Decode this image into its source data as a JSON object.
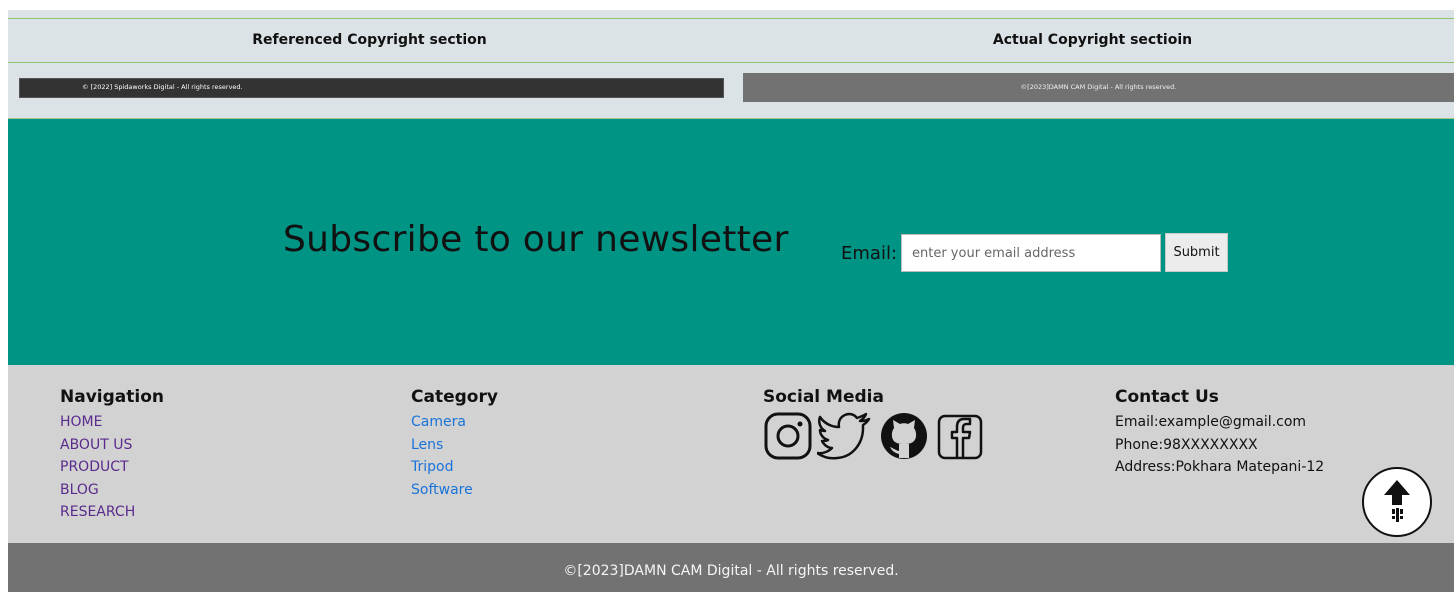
{
  "comparison": {
    "referenced_heading": "Referenced Copyright section",
    "actual_heading": "Actual Copyright sectioin",
    "referenced_text": "© [2022] Spidaworks Digital - All rights reserved.",
    "actual_text": "©[2023]DAMN CAM Digital - All rights reserved."
  },
  "newsletter": {
    "title": "Subscribe to our newsletter",
    "email_label": "Email:",
    "email_placeholder": "enter your email address",
    "submit_label": "Submit",
    "background_color": "#009485"
  },
  "footer": {
    "navigation": {
      "heading": "Navigation",
      "items": [
        "HOME",
        "ABOUT US",
        "PRODUCT",
        "BLOG",
        "RESEARCH"
      ]
    },
    "category": {
      "heading": "Category",
      "items": [
        "Camera",
        "Lens",
        "Tripod",
        "Software"
      ]
    },
    "social": {
      "heading": "Social Media",
      "icons": [
        "instagram-icon",
        "twitter-icon",
        "github-icon",
        "facebook-icon"
      ]
    },
    "contact": {
      "heading": "Contact Us",
      "email": "Email:example@gmail.com",
      "phone": "Phone:98XXXXXXXX",
      "address": "Address:Pokhara Matepani-12"
    }
  },
  "scroll_top_icon": "arrow-up-icon",
  "copyright": "©[2023]DAMN CAM Digital - All rights reserved."
}
